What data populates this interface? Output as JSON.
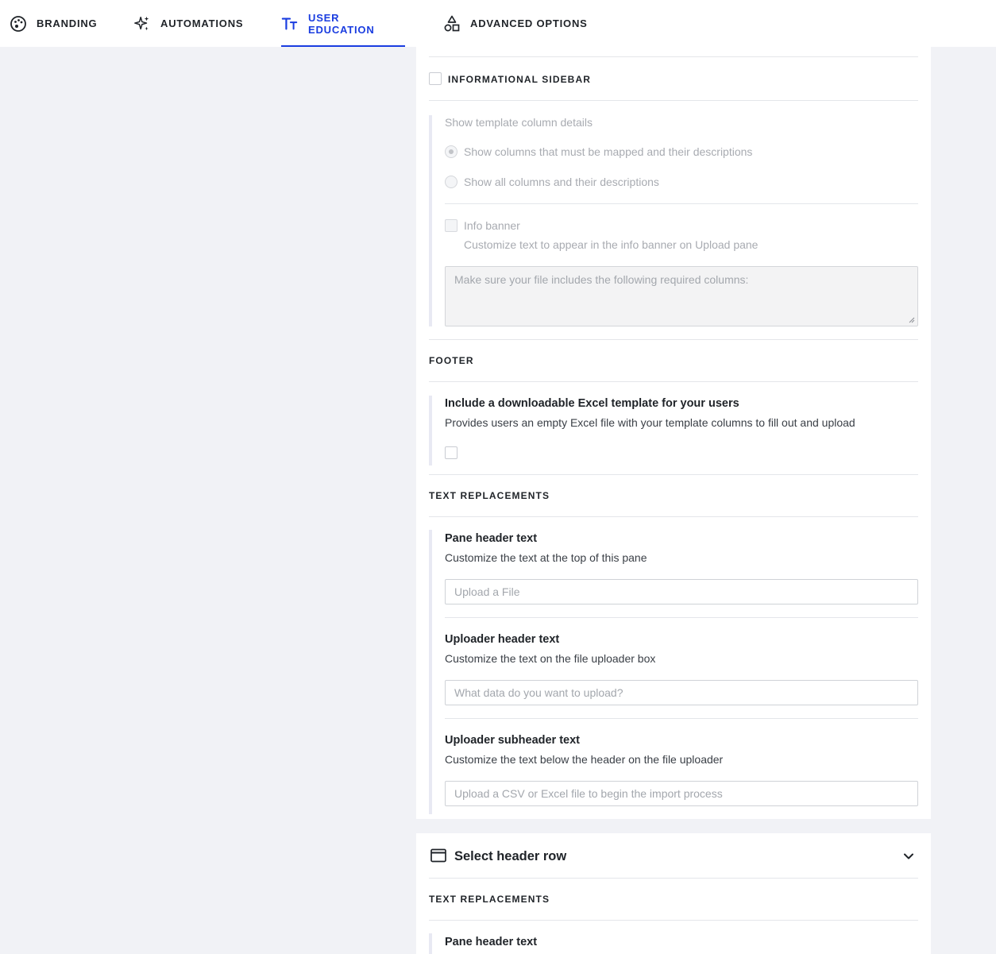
{
  "nav": {
    "tabs": [
      {
        "label": "BRANDING",
        "icon": "palette-icon",
        "active": false
      },
      {
        "label": "AUTOMATIONS",
        "icon": "sparkles-icon",
        "active": false
      },
      {
        "label": "USER EDUCATION",
        "icon": "text-size-icon",
        "active": true
      },
      {
        "label": "ADVANCED OPTIONS",
        "icon": "shapes-icon",
        "active": false
      }
    ],
    "active_color": "#1a3de0"
  },
  "upload_pane": {
    "informational_sidebar": {
      "label": "INFORMATIONAL SIDEBAR",
      "checked": false,
      "column_details": {
        "label": "Show template column details",
        "options": [
          {
            "label": "Show columns that must be mapped and their descriptions",
            "selected": true
          },
          {
            "label": "Show all columns and their descriptions",
            "selected": false
          }
        ]
      },
      "info_banner": {
        "label": "Info banner",
        "description": "Customize text to appear in the info banner on Upload pane",
        "placeholder": "Make sure your file includes the following required columns:",
        "checked": false
      }
    },
    "footer": {
      "title": "FOOTER",
      "excel_template": {
        "label": "Include a downloadable Excel template for your users",
        "description": "Provides users an empty Excel file with your template columns to fill out and upload",
        "checked": false
      }
    },
    "text_replacements": {
      "title": "TEXT REPLACEMENTS",
      "fields": [
        {
          "label": "Pane header text",
          "description": "Customize the text at the top of this pane",
          "placeholder": "Upload a File"
        },
        {
          "label": "Uploader header text",
          "description": "Customize the text on the file uploader box",
          "placeholder": "What data do you want to upload?"
        },
        {
          "label": "Uploader subheader text",
          "description": "Customize the text below the header on the file uploader",
          "placeholder": "Upload a CSV or Excel file to begin the import process"
        }
      ]
    }
  },
  "select_header_row": {
    "title": "Select header row",
    "text_replacements": {
      "title": "TEXT REPLACEMENTS",
      "fields": [
        {
          "label": "Pane header text"
        }
      ]
    }
  }
}
